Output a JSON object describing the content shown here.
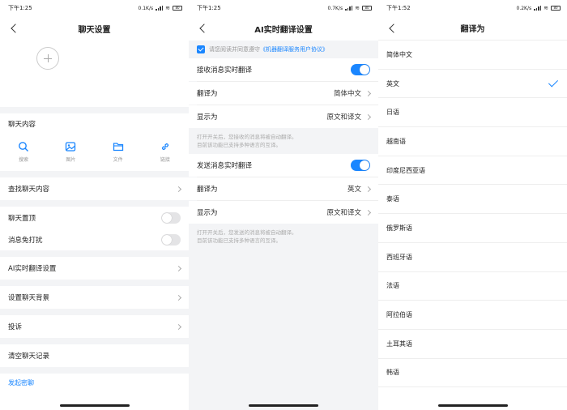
{
  "screens": {
    "left": {
      "status": {
        "time": "下午1:25",
        "speed": "0.1K/s",
        "battery": "80"
      },
      "title": "聊天设置",
      "chat_content_label": "聊天内容",
      "tools": [
        {
          "label": "搜索",
          "icon": "search-icon"
        },
        {
          "label": "图片",
          "icon": "image-icon"
        },
        {
          "label": "文件",
          "icon": "folder-icon"
        },
        {
          "label": "链接",
          "icon": "link-icon"
        }
      ],
      "find_content": "查找聊天内容",
      "pin_chat": "聊天置顶",
      "mute": "消息免打扰",
      "ai_translate": "AI实时翻译设置",
      "background": "设置聊天背景",
      "report": "投诉",
      "clear": "清空聊天记录",
      "start_group": "发起密聊"
    },
    "middle": {
      "status": {
        "time": "下午1:25",
        "speed": "0.7K/s",
        "battery": "80"
      },
      "title": "AI实时翻译设置",
      "consent_prefix": "请您阅读并同意遵守",
      "consent_link": "《机器翻译服务用户协议》",
      "receive": {
        "label": "接收消息实时翻译",
        "translate_to_label": "翻译为",
        "translate_to_value": "简体中文",
        "display_label": "显示为",
        "display_value": "原文和译文",
        "hint_1": "打开开关后，您接收的消息将被自动翻译。",
        "hint_2": "目前该功能已支持多种语言的互译。"
      },
      "send": {
        "label": "发送消息实时翻译",
        "translate_to_label": "翻译为",
        "translate_to_value": "英文",
        "display_label": "显示为",
        "display_value": "原文和译文",
        "hint_1": "打开开关后，您发送的消息将被自动翻译。",
        "hint_2": "目前该功能已支持多种语言的互译。"
      }
    },
    "right": {
      "status": {
        "time": "下午1:52",
        "speed": "0.2K/s",
        "battery": "80"
      },
      "title": "翻译为",
      "languages": [
        "简体中文",
        "英文",
        "日语",
        "越南语",
        "印度尼西亚语",
        "泰语",
        "俄罗斯语",
        "西班牙语",
        "法语",
        "阿拉伯语",
        "土耳其语",
        "韩语"
      ],
      "selected_index": 1
    }
  },
  "colors": {
    "accent": "#1a86ff",
    "bg": "#f3f4f6"
  }
}
